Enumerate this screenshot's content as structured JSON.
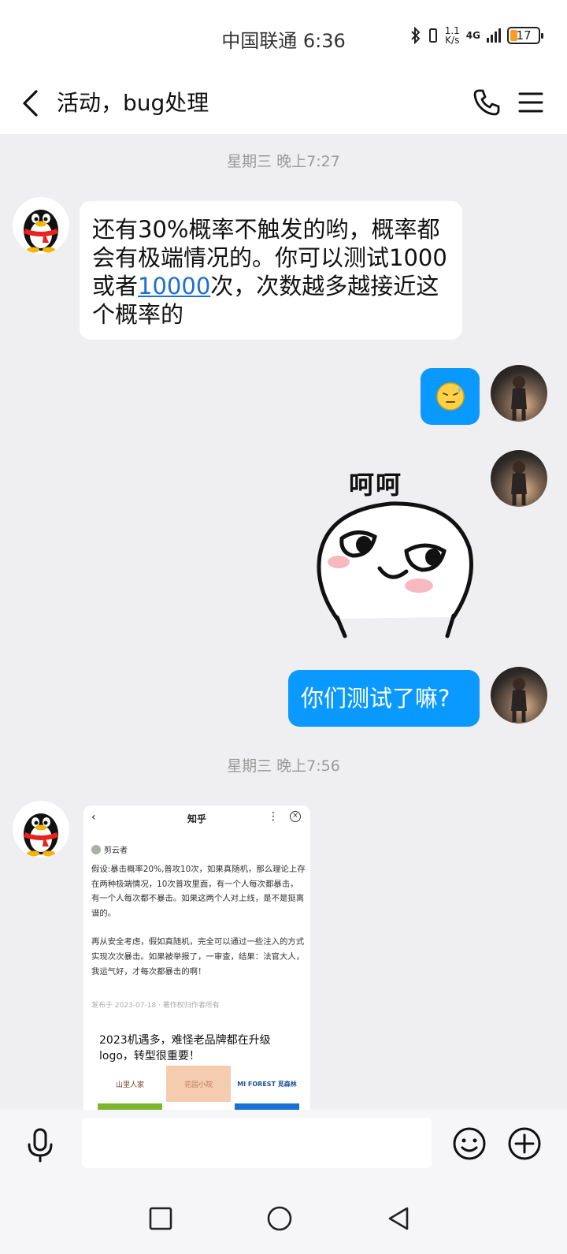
{
  "status_bar": {
    "carrier_time": "中国联通 6:36",
    "net_speed_top": "1.1",
    "net_speed_bottom": "K/s",
    "network": "4G",
    "battery": "17"
  },
  "header": {
    "title": "活动，bug处理"
  },
  "timestamps": [
    "星期三 晚上7:27",
    "星期三 晚上7:56"
  ],
  "messages": {
    "m1_before": "还有30%概率不触发的哟，概率都会有极端情况的。你可以测试1000或者",
    "m1_link": "10000",
    "m1_after": "次，次数越多越接近这个概率的",
    "sticker_caption": "呵呵",
    "m3": "你们测试了嘛?"
  },
  "screenshot": {
    "top_title": "知乎",
    "author": "剪云者",
    "para1": "假设:暴击概率20%,普攻10次，如果真随机，那么理论上存在两种极端情况，10次普攻里面，有一个人每次都暴击，有一个人每次都不暴击。如果这两个人对上线，是不是挺离谱的。",
    "para2": "再从安全考虑，假如真随机，完全可以通过一些注入的方式实现次次暴击。如果被举报了，一审查，结果：法官大人，我运气好，才每次都暴击的啊！",
    "date": "发布于 2023-07-18 · 著作权归作者所有",
    "ad_text": "2023机遇多，难怪老品牌都在升级logo，转型很重要！",
    "logo_left": "山里人家",
    "logo_mid": "花园小院",
    "logo_right": "MI FOREST 觅森林"
  },
  "input": {
    "placeholder": ""
  },
  "colors": {
    "accent_blue": "#0a99ff",
    "background": "#efeff1"
  }
}
